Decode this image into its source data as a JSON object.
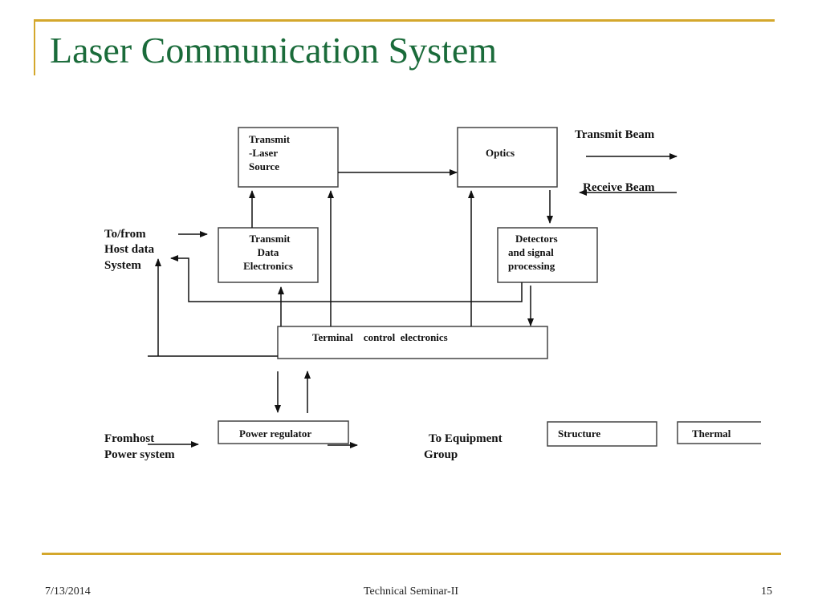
{
  "slide": {
    "title": "Laser Communication System",
    "footer": {
      "date": "7/13/2014",
      "center": "Technical Seminar-II",
      "page": "15"
    },
    "colors": {
      "title": "#1a6b3a",
      "accent_rule": "#d4a72c"
    }
  },
  "diagram": {
    "blocks": {
      "transmit_laser_source": [
        "Transmit",
        "-Laser",
        "Source"
      ],
      "optics": [
        "Optics"
      ],
      "transmit_data_electronics": [
        "Transmit",
        "Data",
        "Electronics"
      ],
      "detectors_signal_processing": [
        "Detectors",
        "and signal",
        "processing"
      ],
      "terminal_control_electronics": [
        "Terminal    control  electronics"
      ],
      "power_regulator": [
        "Power regulator"
      ],
      "structure": [
        "Structure"
      ],
      "thermal": [
        "Thermal"
      ]
    },
    "labels": {
      "transmit_beam": "Transmit Beam",
      "receive_beam": "Receive Beam",
      "host_data": [
        "To/from",
        "Host data",
        "System"
      ],
      "host_power": [
        "Fromhost",
        "Power system"
      ],
      "equipment_group": [
        "To Equipment",
        "Group"
      ]
    }
  }
}
